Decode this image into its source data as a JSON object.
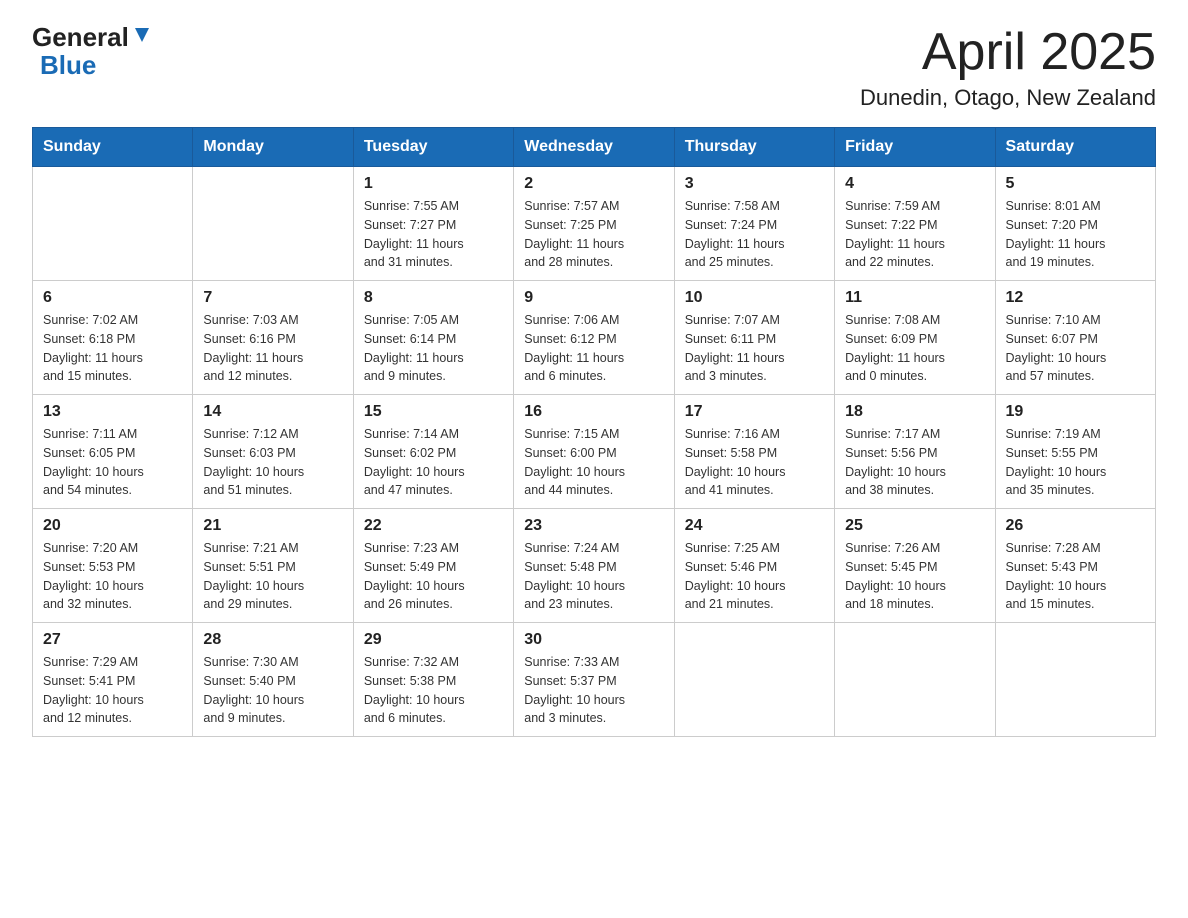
{
  "header": {
    "logo_general": "General",
    "logo_blue": "Blue",
    "month_title": "April 2025",
    "location": "Dunedin, Otago, New Zealand"
  },
  "days_of_week": [
    "Sunday",
    "Monday",
    "Tuesday",
    "Wednesday",
    "Thursday",
    "Friday",
    "Saturday"
  ],
  "weeks": [
    [
      {
        "day": "",
        "info": ""
      },
      {
        "day": "",
        "info": ""
      },
      {
        "day": "1",
        "info": "Sunrise: 7:55 AM\nSunset: 7:27 PM\nDaylight: 11 hours\nand 31 minutes."
      },
      {
        "day": "2",
        "info": "Sunrise: 7:57 AM\nSunset: 7:25 PM\nDaylight: 11 hours\nand 28 minutes."
      },
      {
        "day": "3",
        "info": "Sunrise: 7:58 AM\nSunset: 7:24 PM\nDaylight: 11 hours\nand 25 minutes."
      },
      {
        "day": "4",
        "info": "Sunrise: 7:59 AM\nSunset: 7:22 PM\nDaylight: 11 hours\nand 22 minutes."
      },
      {
        "day": "5",
        "info": "Sunrise: 8:01 AM\nSunset: 7:20 PM\nDaylight: 11 hours\nand 19 minutes."
      }
    ],
    [
      {
        "day": "6",
        "info": "Sunrise: 7:02 AM\nSunset: 6:18 PM\nDaylight: 11 hours\nand 15 minutes."
      },
      {
        "day": "7",
        "info": "Sunrise: 7:03 AM\nSunset: 6:16 PM\nDaylight: 11 hours\nand 12 minutes."
      },
      {
        "day": "8",
        "info": "Sunrise: 7:05 AM\nSunset: 6:14 PM\nDaylight: 11 hours\nand 9 minutes."
      },
      {
        "day": "9",
        "info": "Sunrise: 7:06 AM\nSunset: 6:12 PM\nDaylight: 11 hours\nand 6 minutes."
      },
      {
        "day": "10",
        "info": "Sunrise: 7:07 AM\nSunset: 6:11 PM\nDaylight: 11 hours\nand 3 minutes."
      },
      {
        "day": "11",
        "info": "Sunrise: 7:08 AM\nSunset: 6:09 PM\nDaylight: 11 hours\nand 0 minutes."
      },
      {
        "day": "12",
        "info": "Sunrise: 7:10 AM\nSunset: 6:07 PM\nDaylight: 10 hours\nand 57 minutes."
      }
    ],
    [
      {
        "day": "13",
        "info": "Sunrise: 7:11 AM\nSunset: 6:05 PM\nDaylight: 10 hours\nand 54 minutes."
      },
      {
        "day": "14",
        "info": "Sunrise: 7:12 AM\nSunset: 6:03 PM\nDaylight: 10 hours\nand 51 minutes."
      },
      {
        "day": "15",
        "info": "Sunrise: 7:14 AM\nSunset: 6:02 PM\nDaylight: 10 hours\nand 47 minutes."
      },
      {
        "day": "16",
        "info": "Sunrise: 7:15 AM\nSunset: 6:00 PM\nDaylight: 10 hours\nand 44 minutes."
      },
      {
        "day": "17",
        "info": "Sunrise: 7:16 AM\nSunset: 5:58 PM\nDaylight: 10 hours\nand 41 minutes."
      },
      {
        "day": "18",
        "info": "Sunrise: 7:17 AM\nSunset: 5:56 PM\nDaylight: 10 hours\nand 38 minutes."
      },
      {
        "day": "19",
        "info": "Sunrise: 7:19 AM\nSunset: 5:55 PM\nDaylight: 10 hours\nand 35 minutes."
      }
    ],
    [
      {
        "day": "20",
        "info": "Sunrise: 7:20 AM\nSunset: 5:53 PM\nDaylight: 10 hours\nand 32 minutes."
      },
      {
        "day": "21",
        "info": "Sunrise: 7:21 AM\nSunset: 5:51 PM\nDaylight: 10 hours\nand 29 minutes."
      },
      {
        "day": "22",
        "info": "Sunrise: 7:23 AM\nSunset: 5:49 PM\nDaylight: 10 hours\nand 26 minutes."
      },
      {
        "day": "23",
        "info": "Sunrise: 7:24 AM\nSunset: 5:48 PM\nDaylight: 10 hours\nand 23 minutes."
      },
      {
        "day": "24",
        "info": "Sunrise: 7:25 AM\nSunset: 5:46 PM\nDaylight: 10 hours\nand 21 minutes."
      },
      {
        "day": "25",
        "info": "Sunrise: 7:26 AM\nSunset: 5:45 PM\nDaylight: 10 hours\nand 18 minutes."
      },
      {
        "day": "26",
        "info": "Sunrise: 7:28 AM\nSunset: 5:43 PM\nDaylight: 10 hours\nand 15 minutes."
      }
    ],
    [
      {
        "day": "27",
        "info": "Sunrise: 7:29 AM\nSunset: 5:41 PM\nDaylight: 10 hours\nand 12 minutes."
      },
      {
        "day": "28",
        "info": "Sunrise: 7:30 AM\nSunset: 5:40 PM\nDaylight: 10 hours\nand 9 minutes."
      },
      {
        "day": "29",
        "info": "Sunrise: 7:32 AM\nSunset: 5:38 PM\nDaylight: 10 hours\nand 6 minutes."
      },
      {
        "day": "30",
        "info": "Sunrise: 7:33 AM\nSunset: 5:37 PM\nDaylight: 10 hours\nand 3 minutes."
      },
      {
        "day": "",
        "info": ""
      },
      {
        "day": "",
        "info": ""
      },
      {
        "day": "",
        "info": ""
      }
    ]
  ]
}
